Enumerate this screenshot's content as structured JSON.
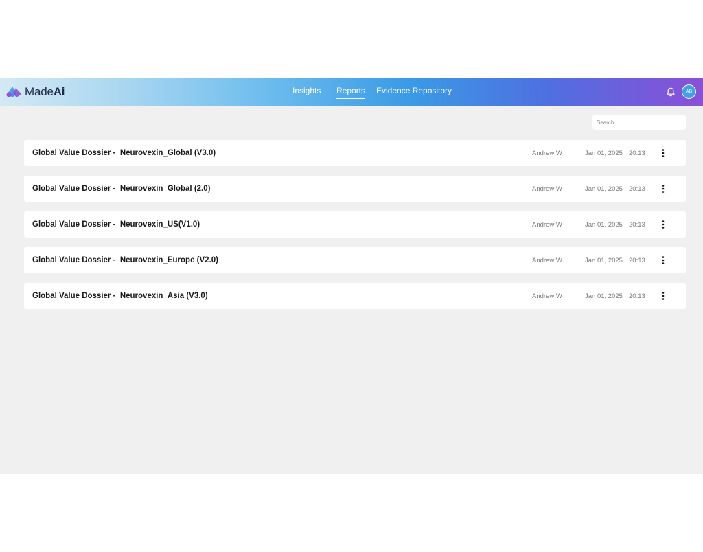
{
  "app": {
    "logo_text_light": "Made",
    "logo_text_bold": "Ai",
    "brand_colors": {
      "primary": "#3a9be6",
      "accent": "#8b4fd8"
    }
  },
  "nav": {
    "items": [
      {
        "label": "Insights",
        "active": false
      },
      {
        "label": "Reports",
        "active": true
      },
      {
        "label": "Evidence Repository",
        "active": false
      }
    ]
  },
  "header": {
    "bell_icon": "bell-icon",
    "avatar_initials": "AB"
  },
  "search": {
    "placeholder": "Search",
    "value": ""
  },
  "reports": [
    {
      "title": "Global Value Dossier -  Neurovexin_Global (V3.0)",
      "author": "Andrew W",
      "date": "Jan 01, 2025",
      "time": "20:13"
    },
    {
      "title": "Global Value Dossier -  Neurovexin_Global (2.0)",
      "author": "Andrew W",
      "date": "Jan 01, 2025",
      "time": "20:13"
    },
    {
      "title": "Global Value Dossier -  Neurovexin_US(V1.0)",
      "author": "Andrew W",
      "date": "Jan 01, 2025",
      "time": "20:13"
    },
    {
      "title": "Global Value Dossier -  Neurovexin_Europe (V2.0)",
      "author": "Andrew W",
      "date": "Jan 01, 2025",
      "time": "20:13"
    },
    {
      "title": "Global Value Dossier -  Neurovexin_Asia (V3.0)",
      "author": "Andrew W",
      "date": "Jan 01, 2025",
      "time": "20:13"
    }
  ]
}
